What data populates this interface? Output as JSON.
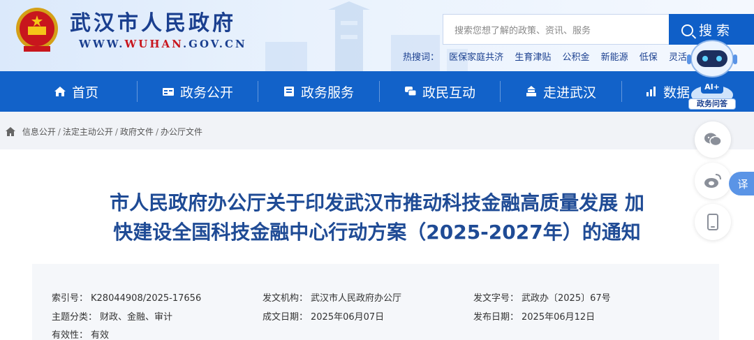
{
  "header": {
    "site_title": "武汉市人民政府",
    "url_pre": "WWW.",
    "url_brand": "WUHAN",
    "url_post": ".GOV.CN",
    "search_placeholder": "搜索您想了解的政策、资讯、服务",
    "search_button": "搜 索",
    "hot_label": "热搜词：",
    "hot_terms": [
      "医保家庭共济",
      "生育津贴",
      "公积金",
      "新能源",
      "低保",
      "灵活"
    ]
  },
  "nav": {
    "items": [
      {
        "label": "首页",
        "icon": "home-icon"
      },
      {
        "label": "政务公开",
        "icon": "open-gov-icon"
      },
      {
        "label": "政务服务",
        "icon": "service-icon"
      },
      {
        "label": "政民互动",
        "icon": "interaction-icon"
      },
      {
        "label": "走进武汉",
        "icon": "city-icon"
      },
      {
        "label": "数据",
        "icon": "data-icon"
      }
    ]
  },
  "breadcrumb": [
    "信息公开",
    "法定主动公开",
    "政府文件",
    "办公厅文件"
  ],
  "document": {
    "title_line1": "市人民政府办公厅关于印发武汉市推动科技金融高质量发展 加",
    "title_line2": "快建设全国科技金融中心行动方案（2025-2027年）的通知",
    "meta": {
      "index_label": "索引号：",
      "index_value": "K28044908/2025-17656",
      "issuer_label": "发文机构：",
      "issuer_value": "武汉市人民政府办公厅",
      "doc_no_label": "发文字号：",
      "doc_no_value": "武政办〔2025〕67号",
      "topic_label": "主题分类：",
      "topic_value": "财政、金融、审计",
      "made_label": "成文日期：",
      "made_value": "2025年06月07日",
      "pub_label": "发布日期：",
      "pub_value": "2025年06月12日",
      "valid_label": "有效性：",
      "valid_value": "有效"
    }
  },
  "side_tools": {
    "robot_badge": "AI+",
    "robot_label": "政务问答",
    "translate_label": "译",
    "icons": [
      "wechat-icon",
      "weibo-icon",
      "mobile-icon"
    ]
  },
  "colors": {
    "nav_bg": "#1262c9",
    "title_blue": "#1f4b95",
    "brand_red": "#c8161d"
  }
}
